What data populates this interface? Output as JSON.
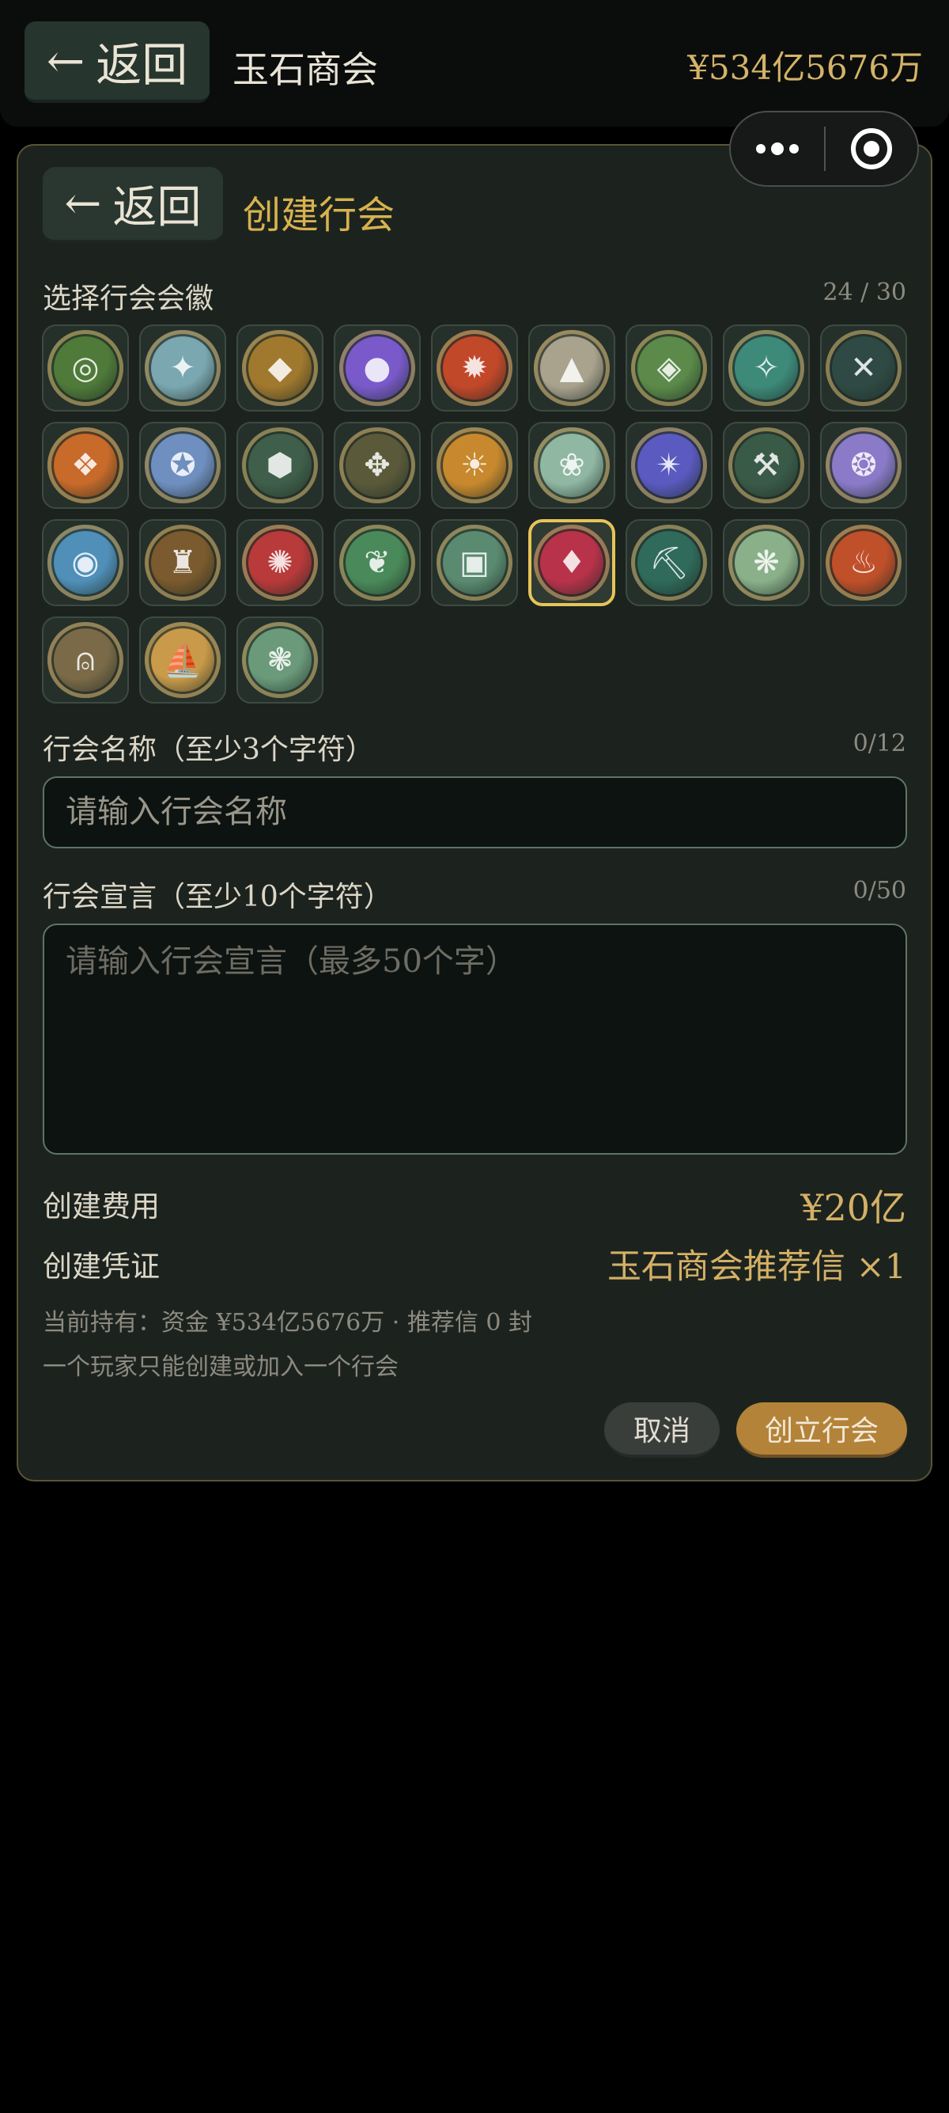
{
  "topbar": {
    "back_label": "返回",
    "title": "玉石商会",
    "money": "¥534亿5676万"
  },
  "panel": {
    "back_label": "返回",
    "title": "创建行会",
    "emblem_label": "选择行会会徽",
    "emblem_count": "24 / 30",
    "emblems": [
      {
        "icon": "jade-disc-emblem",
        "color": "#4f7a3a"
      },
      {
        "icon": "crane-emblem",
        "color": "#7aa7b0"
      },
      {
        "icon": "tiger-emblem",
        "color": "#a0782e"
      },
      {
        "icon": "purple-orb-emblem",
        "color": "#7a5acb"
      },
      {
        "icon": "phoenix-emblem",
        "color": "#c2482a"
      },
      {
        "icon": "mountain-emblem",
        "color": "#a9a28d"
      },
      {
        "icon": "jade-gem-emblem",
        "color": "#5b8a4a"
      },
      {
        "icon": "dragon-emblem",
        "color": "#3d8a7a"
      },
      {
        "icon": "crossed-swords-emblem",
        "color": "#2f4a44"
      },
      {
        "icon": "lantern-emblem",
        "color": "#c76a2a"
      },
      {
        "icon": "wolf-emblem",
        "color": "#6f8fc0"
      },
      {
        "icon": "turtle-emblem",
        "color": "#3f5f4a"
      },
      {
        "icon": "eagle-emblem",
        "color": "#5a5a3a"
      },
      {
        "icon": "lion-emblem",
        "color": "#c8892e"
      },
      {
        "icon": "fan-emblem",
        "color": "#8fb7a2"
      },
      {
        "icon": "compass-star-emblem",
        "color": "#5a5ac0"
      },
      {
        "icon": "hammer-emblem",
        "color": "#3a5a48"
      },
      {
        "icon": "fox-emblem",
        "color": "#8a7ac8"
      },
      {
        "icon": "pearl-emblem",
        "color": "#4f8fb8"
      },
      {
        "icon": "ox-emblem",
        "color": "#7a5a2e"
      },
      {
        "icon": "fox-mask-emblem",
        "color": "#b83a3a"
      },
      {
        "icon": "peacock-emblem",
        "color": "#4a8a5a"
      },
      {
        "icon": "coin-emblem",
        "color": "#5a8a70"
      },
      {
        "icon": "sword-rose-emblem",
        "color": "#b8324a"
      },
      {
        "icon": "pickaxe-emblem",
        "color": "#2f6a5a"
      },
      {
        "icon": "butterfly-emblem",
        "color": "#8ab08a"
      },
      {
        "icon": "flame-shield-emblem",
        "color": "#c0502a"
      },
      {
        "icon": "bell-emblem",
        "color": "#7a6a48"
      },
      {
        "icon": "treasure-ship-emblem",
        "color": "#c89a4a"
      },
      {
        "icon": "deer-emblem",
        "color": "#6a9a7a"
      }
    ],
    "selected_index": 23,
    "name_label": "行会名称（至少3个字符）",
    "name_count": "0/12",
    "name_placeholder": "请输入行会名称",
    "decl_label": "行会宣言（至少10个字符）",
    "decl_count": "0/50",
    "decl_placeholder": "请输入行会宣言（最多50个字）",
    "fee_label": "创建费用",
    "fee_value": "¥20亿",
    "voucher_label": "创建凭证",
    "voucher_value": "玉石商会推荐信 ×1",
    "holdings_note": "当前持有：资金 ¥534亿5676万 · 推荐信 0 封",
    "rule_note": "一个玩家只能创建或加入一个行会",
    "cancel_label": "取消",
    "create_label": "创立行会"
  }
}
